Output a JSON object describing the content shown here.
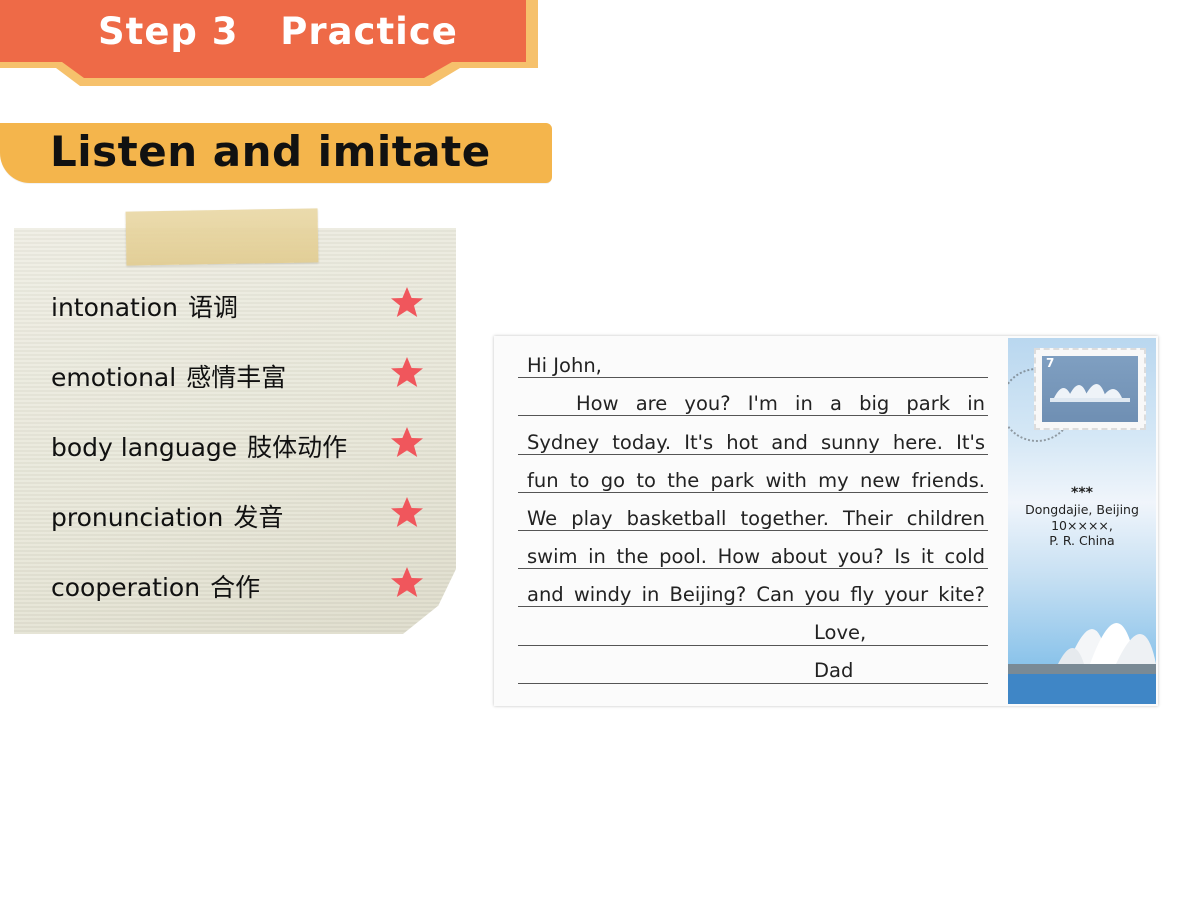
{
  "header": {
    "step": "Step 3",
    "title": "Practice",
    "banner_color": "#ee6a47"
  },
  "section": {
    "title": "Listen and imitate",
    "color": "#f4b54c"
  },
  "note": {
    "items": [
      {
        "en": "intonation",
        "zh": "语调"
      },
      {
        "en": "emotional",
        "zh": "感情丰富"
      },
      {
        "en": "body language",
        "zh": "肢体动作"
      },
      {
        "en": "pronunciation",
        "zh": "发音"
      },
      {
        "en": "cooperation",
        "zh": "合作"
      }
    ],
    "star_color": "#f0565c"
  },
  "postcard": {
    "greeting": "Hi John,",
    "lines": [
      "How are you? I'm in a big park in",
      "Sydney today. It's hot and sunny here. It's",
      "fun to go to the park with my new friends.",
      "We play basketball together. Their children",
      "swim in the pool. How about you? Is it cold",
      "and windy in Beijing? Can you fly your kite?"
    ],
    "closing": "Love,",
    "signature": "Dad",
    "stamp_value": "7",
    "address": {
      "name": "***",
      "street": "Dongdajie, Beijing",
      "postcode": "10××××,",
      "country": "P. R. China"
    }
  }
}
